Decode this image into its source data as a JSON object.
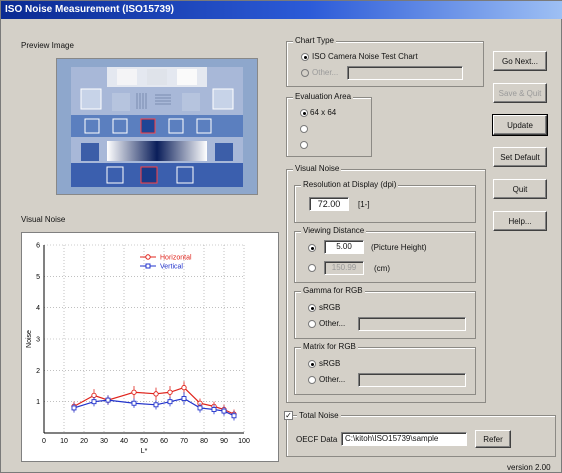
{
  "window": {
    "title": "ISO Noise Measurement (ISO15739)",
    "version": "version 2.00"
  },
  "preview": {
    "label": "Preview Image"
  },
  "chart_type": {
    "title": "Chart Type",
    "option1": "ISO Camera Noise Test Chart",
    "option2": "Other..."
  },
  "evaluation_area": {
    "title": "Evaluation Area",
    "option1": "64 x 64"
  },
  "visual_noise_group": {
    "title": "Visual Noise",
    "resolution": {
      "title": "Resolution at Display (dpi)",
      "value": "72.00",
      "unit": "[1-]"
    },
    "viewing_distance": {
      "title": "Viewing Distance",
      "value1": "5.00",
      "unit1": "(Picture Height)",
      "value2": "150.99",
      "unit2": "(cm)"
    },
    "gamma": {
      "title": "Gamma for RGB",
      "option1": "sRGB",
      "option2": "Other..."
    },
    "matrix": {
      "title": "Matrix for RGB",
      "option1": "sRGB",
      "option2": "Other..."
    }
  },
  "total_noise": {
    "label": "Total Noise",
    "oecf_label": "OECF Data",
    "oecf_path": "C:\\kitoh\\ISO15739\\sample",
    "refer": "Refer"
  },
  "buttons": {
    "go_next": "Go Next...",
    "save_quit": "Save & Quit",
    "update": "Update",
    "set_default": "Set Default",
    "quit": "Quit",
    "help": "Help..."
  },
  "chart_section": {
    "label": "Visual Noise"
  },
  "colors": {
    "horizontal": "#e0241c",
    "vertical": "#2233cc",
    "titlebar": "#0a2a92"
  },
  "chart_data": {
    "type": "line",
    "xlabel": "L*",
    "ylabel": "Noise",
    "xlim": [
      0,
      100
    ],
    "ylim": [
      0,
      6
    ],
    "x_ticks": [
      0,
      10,
      20,
      30,
      40,
      50,
      60,
      70,
      80,
      90,
      100
    ],
    "y_ticks": [
      1,
      2,
      3,
      4,
      5,
      6
    ],
    "legend_position": "top-right",
    "grid": true,
    "series": [
      {
        "name": "Horizontal",
        "color": "#e0241c",
        "x": [
          15,
          25,
          32,
          45,
          56,
          63,
          70,
          78,
          85,
          90,
          95
        ],
        "y": [
          0.85,
          1.2,
          1.05,
          1.3,
          1.25,
          1.3,
          1.45,
          0.95,
          0.85,
          0.75,
          0.6
        ],
        "err": [
          0.15,
          0.2,
          0.15,
          0.2,
          0.2,
          0.2,
          0.2,
          0.15,
          0.15,
          0.15,
          0.15
        ]
      },
      {
        "name": "Vertical",
        "color": "#2233cc",
        "x": [
          15,
          25,
          32,
          45,
          56,
          63,
          70,
          78,
          85,
          90,
          95
        ],
        "y": [
          0.8,
          1.0,
          1.05,
          0.95,
          0.9,
          1.0,
          1.1,
          0.8,
          0.75,
          0.7,
          0.55
        ],
        "err": [
          0.15,
          0.15,
          0.15,
          0.15,
          0.15,
          0.15,
          0.2,
          0.15,
          0.15,
          0.15,
          0.15
        ]
      }
    ]
  }
}
